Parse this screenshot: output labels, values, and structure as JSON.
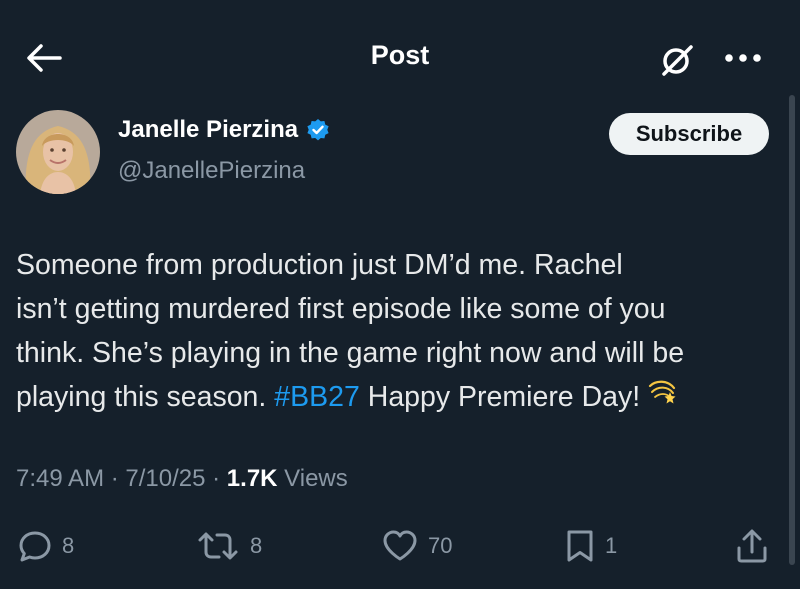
{
  "header": {
    "title": "Post"
  },
  "author": {
    "name": "Janelle Pierzina",
    "handle": "@JanellePierzina",
    "verified": true,
    "subscribe_label": "Subscribe"
  },
  "post": {
    "lines": [
      "Someone from production just DM’d me. Rachel",
      "isn’t getting murdered first episode like some of you",
      "think. She’s playing in the game right now and will be"
    ],
    "last_line_prefix": "playing this season. ",
    "hashtag": "#BB27",
    "last_line_suffix": " Happy Premiere Day!"
  },
  "meta": {
    "time": "7:49 AM",
    "sep1": " · ",
    "date": "7/10/25",
    "sep2": " · ",
    "views_count": "1.7K",
    "views_label": " Views"
  },
  "actions": {
    "replies": "8",
    "reposts": "8",
    "likes": "70",
    "bookmarks": "1"
  },
  "colors": {
    "background": "#15202b",
    "accent": "#1d9bf0",
    "muted": "#8b98a5",
    "text": "#e7e9ea"
  },
  "icons": [
    "back-arrow-icon",
    "grok-icon",
    "more-icon",
    "verified-badge-icon",
    "comet-emoji-icon",
    "reply-icon",
    "repost-icon",
    "like-icon",
    "bookmark-icon",
    "share-icon"
  ]
}
